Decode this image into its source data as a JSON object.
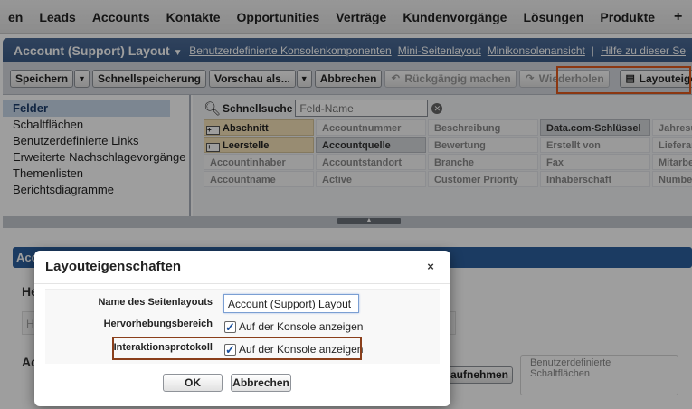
{
  "nav": {
    "tabs": [
      "en",
      "Leads",
      "Accounts",
      "Kontakte",
      "Opportunities",
      "Verträge",
      "Kundenvorgänge",
      "Lösungen",
      "Produkte"
    ],
    "plus": "+"
  },
  "editor": {
    "title": "Account (Support) Layout",
    "links": [
      "Benutzerdefinierte Konsolenkomponenten",
      "Mini-Seitenlayout",
      "Minikonsolenansicht",
      "Hilfe zu dieser Se"
    ],
    "toolbar": {
      "save": "Speichern",
      "quicksave": "Schnellspeicherung",
      "preview": "Vorschau als...",
      "cancel": "Abbrechen",
      "undo": "Rückgängig machen",
      "redo": "Wiederholen",
      "layout_props": "Layouteigenschaften"
    },
    "categories": [
      "Felder",
      "Schaltflächen",
      "Benutzerdefinierte Links",
      "Erweiterte Nachschlagevorgänge",
      "Themenlisten",
      "Berichtsdiagramme"
    ],
    "quicksearch": {
      "label": "Schnellsuche",
      "placeholder": "Feld-Name"
    },
    "fields": [
      {
        "label": "Abschnitt",
        "kind": "section"
      },
      {
        "label": "Accountnummer",
        "kind": "available"
      },
      {
        "label": "Beschreibung",
        "kind": "available"
      },
      {
        "label": "Data.com-Schlüssel",
        "kind": "used"
      },
      {
        "label": "Jahresu",
        "kind": "available"
      },
      {
        "label": "Leerstelle",
        "kind": "section"
      },
      {
        "label": "Accountquelle",
        "kind": "used"
      },
      {
        "label": "Bewertung",
        "kind": "available"
      },
      {
        "label": "Erstellt von",
        "kind": "available"
      },
      {
        "label": "Lieferan",
        "kind": "available"
      },
      {
        "label": "Accountinhaber",
        "kind": "available"
      },
      {
        "label": "Accountstandort",
        "kind": "available"
      },
      {
        "label": "Branche",
        "kind": "available"
      },
      {
        "label": "Fax",
        "kind": "available"
      },
      {
        "label": "Mitarbei",
        "kind": "available"
      },
      {
        "label": "Accountname",
        "kind": "available"
      },
      {
        "label": "Active",
        "kind": "available"
      },
      {
        "label": "Customer Priority",
        "kind": "available"
      },
      {
        "label": "Inhaberschaft",
        "kind": "available"
      },
      {
        "label": "Number",
        "kind": "available"
      }
    ]
  },
  "background": {
    "section_bar": "Acc",
    "heading1": "He",
    "ghost": "H",
    "heading2": "Ac",
    "add_button": "aufnehmen",
    "custom_buttons": "Benutzerdefinierte Schaltflächen"
  },
  "dialog": {
    "title": "Layouteigenschaften",
    "close": "×",
    "layout_name_label": "Name des Seitenlayouts",
    "layout_name_value": "Account (Support) Layout",
    "highlight_label": "Hervorhebungsbereich",
    "highlight_checkbox": "Auf der Konsole anzeigen",
    "highlight_checked": true,
    "protocol_label": "Interaktionsprotokoll",
    "protocol_checkbox": "Auf der Konsole anzeigen",
    "protocol_checked": true,
    "ok": "OK",
    "cancel": "Abbrechen"
  }
}
